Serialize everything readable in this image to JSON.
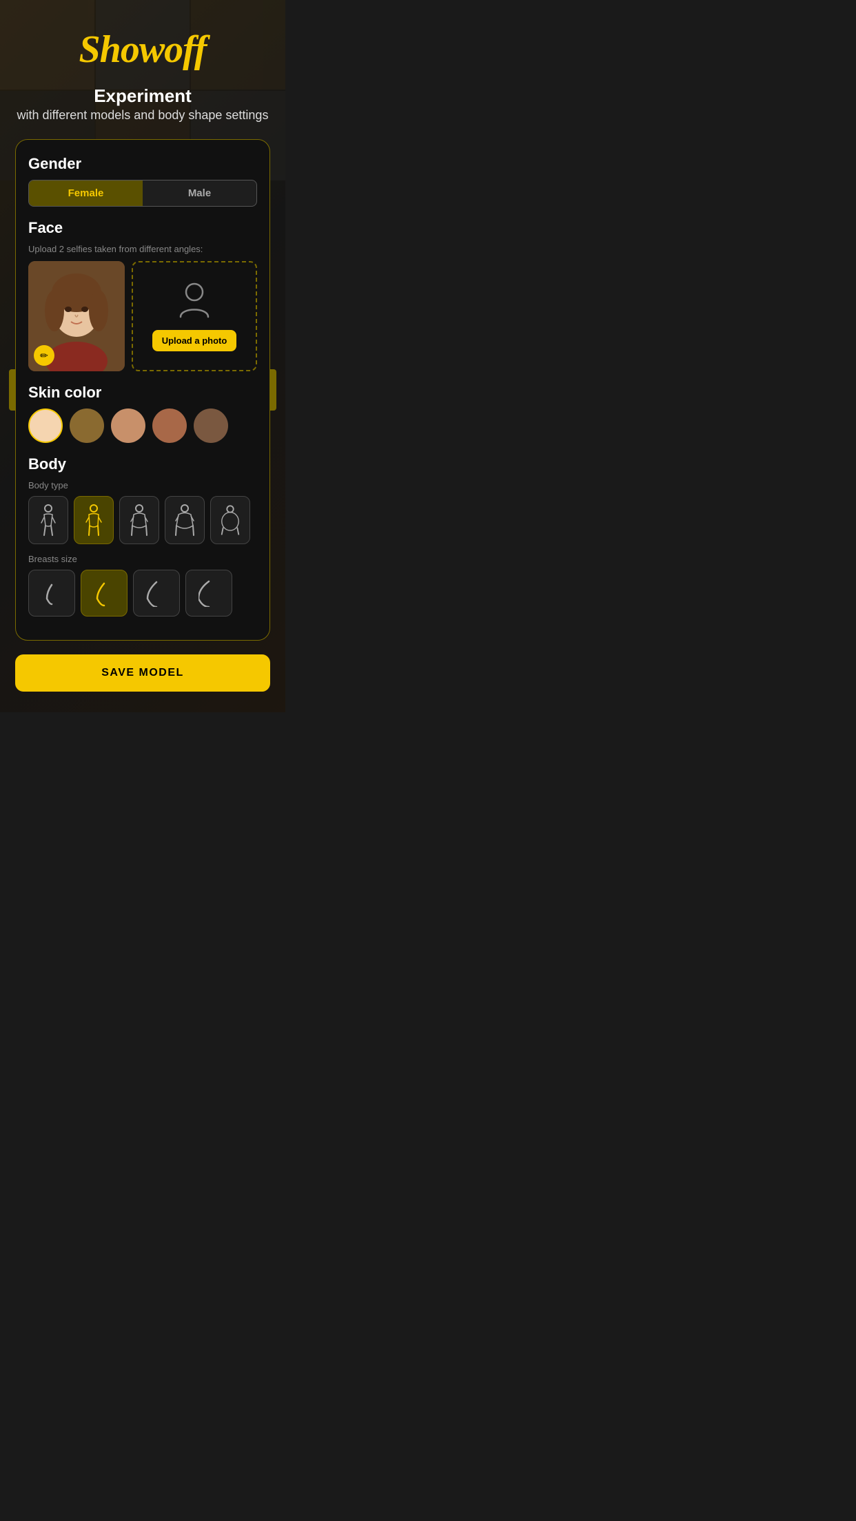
{
  "app": {
    "title": "Showoff"
  },
  "headline": {
    "main": "Experiment",
    "sub": "with different models and body shape settings"
  },
  "gender": {
    "label": "Gender",
    "options": [
      "Female",
      "Male"
    ],
    "selected": "Female"
  },
  "face": {
    "label": "Face",
    "subtitle": "Upload 2 selfies taken from different angles:",
    "edit_icon": "✏",
    "upload_label": "Upload a photo"
  },
  "skin_color": {
    "label": "Skin color",
    "swatches": [
      {
        "color": "#f5d5b0",
        "selected": true
      },
      {
        "color": "#8a6a30",
        "selected": false
      },
      {
        "color": "#c8906a",
        "selected": false
      },
      {
        "color": "#a86848",
        "selected": false
      },
      {
        "color": "#7a5840",
        "selected": false
      }
    ]
  },
  "body": {
    "label": "Body",
    "body_type": {
      "label": "Body type",
      "selected_index": 1,
      "options": [
        {
          "id": "slim",
          "label": "Slim"
        },
        {
          "id": "average",
          "label": "Average"
        },
        {
          "id": "curvy",
          "label": "Curvy"
        },
        {
          "id": "plus1",
          "label": "Plus 1"
        },
        {
          "id": "plus2",
          "label": "Plus 2"
        }
      ]
    },
    "breasts_size": {
      "label": "Breasts size",
      "selected_index": 1,
      "options": [
        {
          "id": "small",
          "label": "Small"
        },
        {
          "id": "medium",
          "label": "Medium"
        },
        {
          "id": "large",
          "label": "Large"
        },
        {
          "id": "xlarge",
          "label": "X-Large"
        }
      ]
    }
  },
  "save_button": {
    "label": "SAVE MODEL"
  }
}
